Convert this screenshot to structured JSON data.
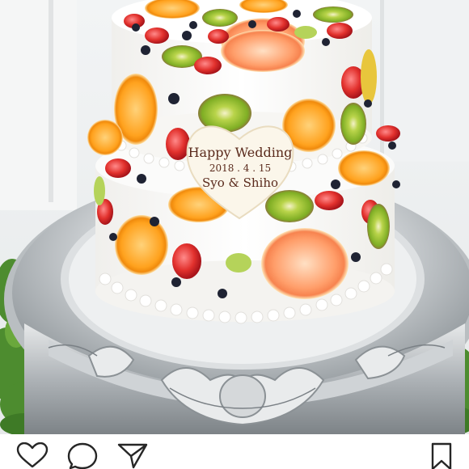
{
  "post": {
    "plaque": {
      "line1": "Happy Wedding",
      "line2": "2018 . 4 . 15",
      "line3": "Syo & Shiho"
    }
  },
  "actions": {
    "like": "heart-icon",
    "comment": "comment-bubble-icon",
    "share": "send-icon",
    "save": "bookmark-icon"
  }
}
